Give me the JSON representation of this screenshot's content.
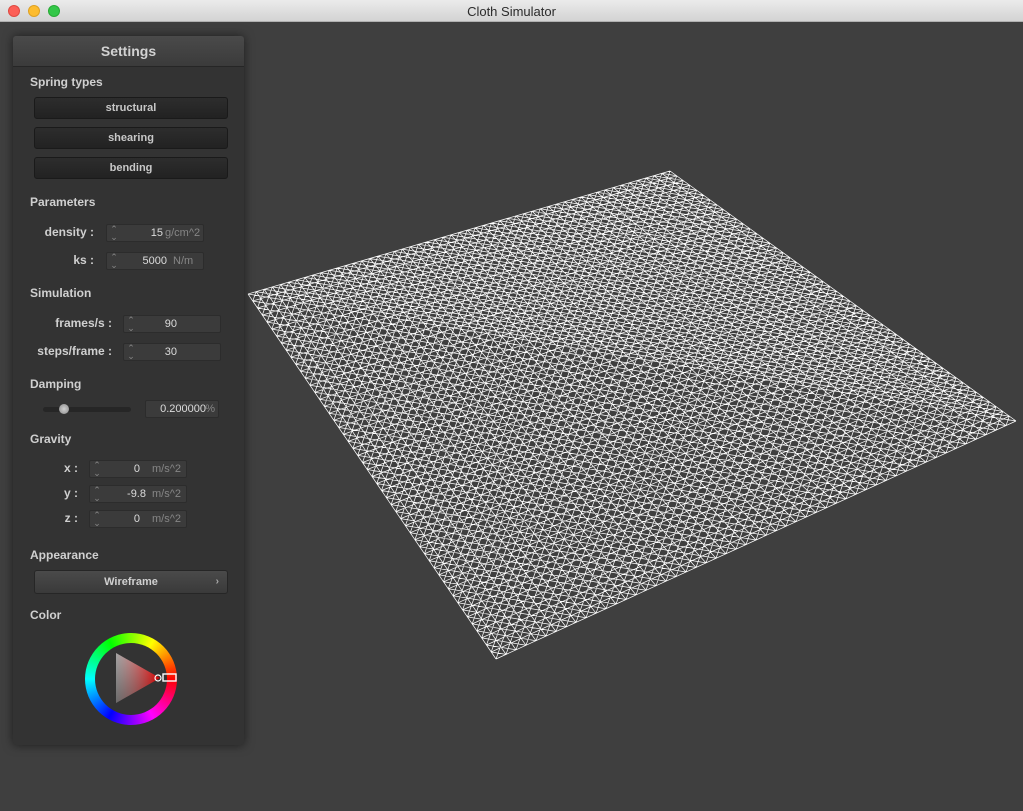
{
  "window": {
    "title": "Cloth Simulator"
  },
  "panel": {
    "title": "Settings",
    "spring_types": {
      "heading": "Spring types",
      "buttons": [
        "structural",
        "shearing",
        "bending"
      ]
    },
    "parameters": {
      "heading": "Parameters",
      "density": {
        "label": "density :",
        "value": "15",
        "unit": "g/cm^2"
      },
      "ks": {
        "label": "ks :",
        "value": "5000",
        "unit": "N/m"
      }
    },
    "simulation": {
      "heading": "Simulation",
      "frames": {
        "label": "frames/s :",
        "value": "90"
      },
      "steps": {
        "label": "steps/frame :",
        "value": "30"
      }
    },
    "damping": {
      "heading": "Damping",
      "value": "0.200000",
      "unit": "%",
      "slider_fraction": 0.2
    },
    "gravity": {
      "heading": "Gravity",
      "x": {
        "label": "x :",
        "value": "0",
        "unit": "m/s^2"
      },
      "y": {
        "label": "y :",
        "value": "-9.8",
        "unit": "m/s^2"
      },
      "z": {
        "label": "z :",
        "value": "0",
        "unit": "m/s^2"
      }
    },
    "appearance": {
      "heading": "Appearance",
      "selected": "Wireframe"
    },
    "color": {
      "heading": "Color",
      "selected_hue": "#ff0000"
    }
  },
  "icons": {
    "spinner": "up-down-spinner-icon",
    "dropdown": "chevron-right-icon"
  }
}
